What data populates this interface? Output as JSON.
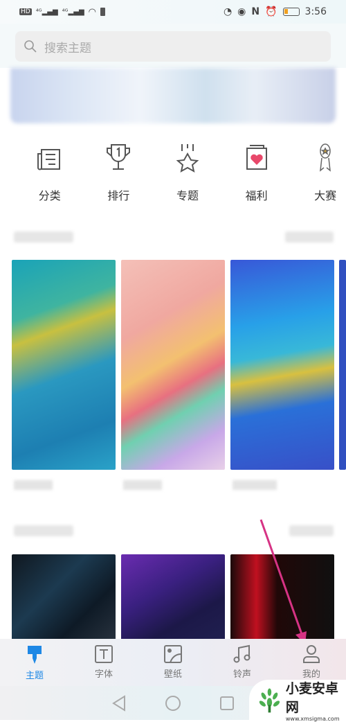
{
  "status_bar": {
    "left_icons": [
      "hd-icon",
      "signal-4g-icon",
      "signal-4g-icon",
      "wifi-icon",
      "battery-saver-icon"
    ],
    "right_icons": [
      "data-saver-icon",
      "eye-comfort-icon",
      "nfc-icon",
      "alarm-icon",
      "battery-icon"
    ],
    "time": "3:56",
    "battery_color": "#f0a020"
  },
  "search": {
    "placeholder": "搜索主题"
  },
  "categories": [
    {
      "label": "分类",
      "icon": "newspaper-icon"
    },
    {
      "label": "排行",
      "icon": "trophy-icon"
    },
    {
      "label": "专题",
      "icon": "star-icon"
    },
    {
      "label": "福利",
      "icon": "heart-gift-icon"
    },
    {
      "label": "大赛",
      "icon": "medal-icon"
    }
  ],
  "tabs": [
    {
      "label": "主题",
      "icon": "theme-brush-icon",
      "active": true
    },
    {
      "label": "字体",
      "icon": "font-icon"
    },
    {
      "label": "壁纸",
      "icon": "wallpaper-icon"
    },
    {
      "label": "铃声",
      "icon": "music-note-icon"
    },
    {
      "label": "我的",
      "icon": "person-icon"
    }
  ],
  "accent_color": "#1e88e5",
  "annotation_arrow_color": "#d63384",
  "watermark": {
    "name": "小麦安卓网",
    "url": "www.xmsigma.com"
  }
}
